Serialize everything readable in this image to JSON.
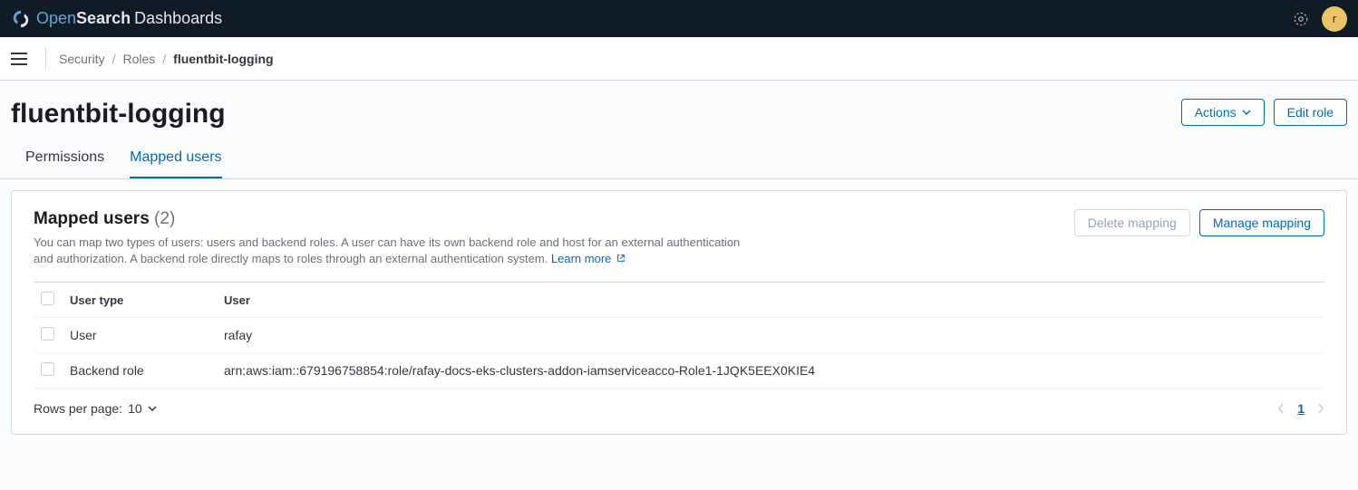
{
  "topbar": {
    "logo_open": "Open",
    "logo_search": "Search",
    "logo_dash": "Dashboards",
    "avatar_letter": "r"
  },
  "breadcrumbs": {
    "items": [
      "Security",
      "Roles",
      "fluentbit-logging"
    ]
  },
  "page": {
    "title": "fluentbit-logging",
    "actions_label": "Actions",
    "edit_label": "Edit role"
  },
  "tabs": {
    "permissions": "Permissions",
    "mapped_users": "Mapped users"
  },
  "panel": {
    "title": "Mapped users",
    "count": "(2)",
    "description": "You can map two types of users: users and backend roles. A user can have its own backend role and host for an external authentication and authorization. A backend role directly maps to roles through an external authentication system.",
    "learn_more": "Learn more",
    "delete_label": "Delete mapping",
    "manage_label": "Manage mapping"
  },
  "table": {
    "header_user_type": "User type",
    "header_user": "User",
    "rows": [
      {
        "type": "User",
        "user": "rafay"
      },
      {
        "type": "Backend role",
        "user": "arn:aws:iam::679196758854:role/rafay-docs-eks-clusters-addon-iamserviceacco-Role1-1JQK5EEX0KIE4"
      }
    ]
  },
  "footer": {
    "rows_label": "Rows per page:",
    "rows_value": "10",
    "current_page": "1"
  }
}
